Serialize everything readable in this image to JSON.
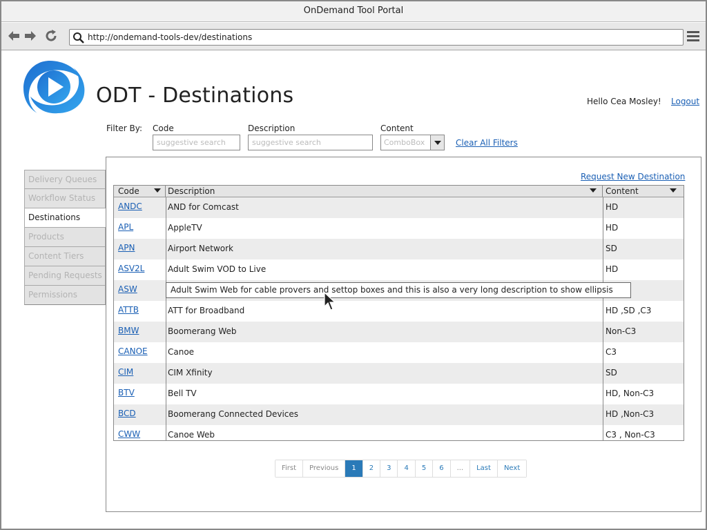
{
  "window": {
    "title": "OnDemand Tool Portal"
  },
  "browser": {
    "url": "http://ondemand-tools-dev/destinations"
  },
  "header": {
    "title": "ODT - Destinations",
    "greeting": "Hello Cea Mosley!",
    "logout_label": "Logout"
  },
  "filters": {
    "filter_by_label": "Filter By:",
    "code_label": "Code",
    "code_placeholder": "suggestive search",
    "description_label": "Description",
    "description_placeholder": "suggestive search",
    "content_label": "Content",
    "content_value": "ComboBox",
    "clear_label": "Clear All Filters"
  },
  "sidebar": {
    "items": [
      {
        "label": "Delivery Queues"
      },
      {
        "label": "Workflow Status"
      },
      {
        "label": "Destinations"
      },
      {
        "label": "Products"
      },
      {
        "label": "Content Tiers"
      },
      {
        "label": "Pending Requests"
      },
      {
        "label": "Permissions"
      }
    ],
    "active_index": 2
  },
  "main": {
    "request_new_label": "Request New Destination",
    "columns": [
      "Code",
      "Description",
      "Content"
    ],
    "rows": [
      {
        "code": "ANDC",
        "description": "AND for Comcast",
        "content": "HD"
      },
      {
        "code": "APL",
        "description": "AppleTV",
        "content": "HD"
      },
      {
        "code": "APN",
        "description": "Airport Network",
        "content": "SD"
      },
      {
        "code": "ASV2L",
        "description": "Adult Swim VOD to Live",
        "content": "HD"
      },
      {
        "code": "ASW",
        "description": "",
        "content": ""
      },
      {
        "code": "ATTB",
        "description": "ATT for Broadband",
        "content": "HD ,SD ,C3"
      },
      {
        "code": "BMW",
        "description": "Boomerang Web",
        "content": "Non-C3"
      },
      {
        "code": "CANOE",
        "description": "Canoe",
        "content": "C3"
      },
      {
        "code": "CIM",
        "description": "CIM Xfinity",
        "content": "SD"
      },
      {
        "code": "BTV",
        "description": "Bell TV",
        "content": "HD, Non-C3"
      },
      {
        "code": "BCD",
        "description": "Boomerang Connected Devices",
        "content": "HD ,Non-C3"
      },
      {
        "code": "CWW",
        "description": "Canoe Web",
        "content": "C3 , Non-C3"
      }
    ],
    "tooltip": "Adult Swim Web for cable provers and settop boxes and this is also a very long description to show ellipsis"
  },
  "pagination": {
    "first": "First",
    "previous": "Previous",
    "pages": [
      "1",
      "2",
      "3",
      "4",
      "5",
      "6"
    ],
    "ellipsis": "...",
    "last": "Last",
    "next": "Next",
    "current": "1"
  },
  "colors": {
    "link": "#1a5fb4",
    "accent": "#2a7ab8",
    "logo": "#2a86d6"
  },
  "icons": {
    "back": "arrow-left-icon",
    "forward": "arrow-right-icon",
    "reload": "reload-icon",
    "search": "search-icon",
    "menu": "hamburger-menu-icon",
    "logo": "play-logo-icon",
    "sort": "sort-down-icon",
    "dropdown": "chevron-down-icon",
    "cursor": "mouse-pointer-icon"
  }
}
